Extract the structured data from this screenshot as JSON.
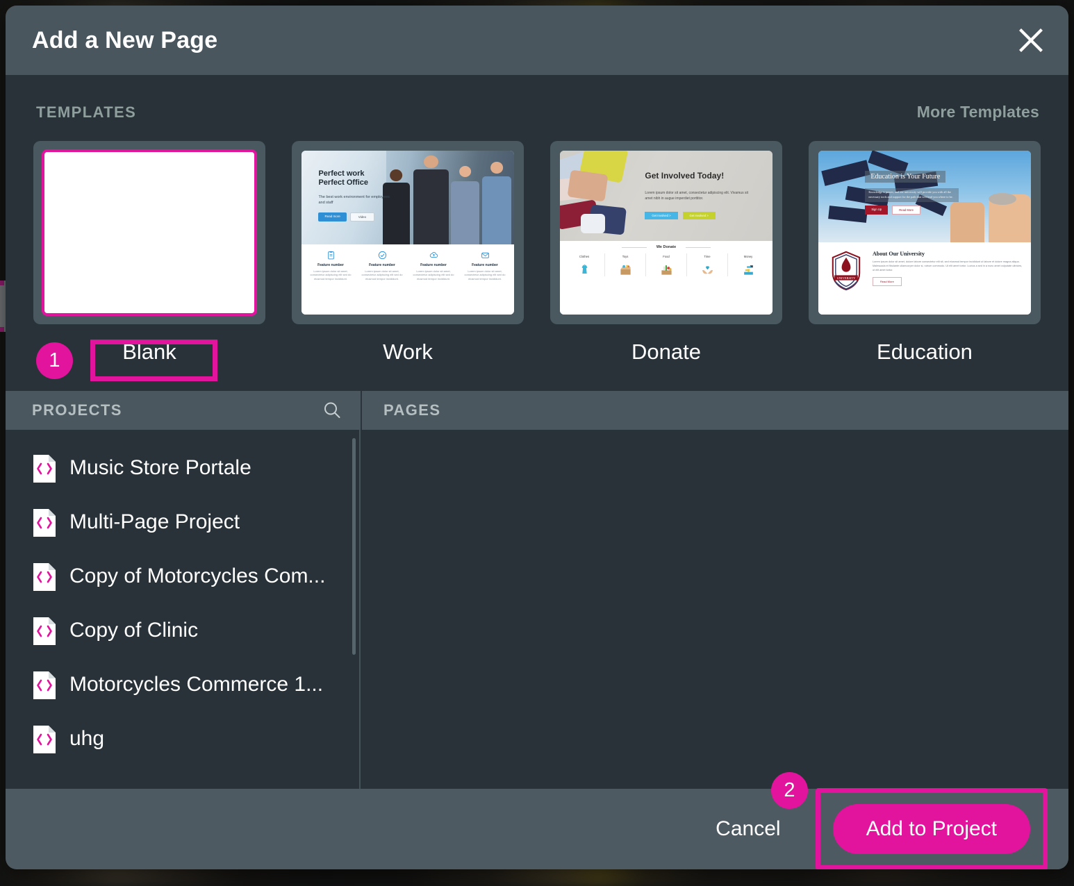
{
  "dialog": {
    "title": "Add a New Page",
    "close_icon": "close-icon"
  },
  "templates_section": {
    "label": "TEMPLATES",
    "more_link": "More Templates",
    "items": [
      {
        "label": "Blank",
        "selected": true
      },
      {
        "label": "Work",
        "selected": false
      },
      {
        "label": "Donate",
        "selected": false
      },
      {
        "label": "Education",
        "selected": false
      }
    ]
  },
  "template_previews": {
    "work": {
      "title_line1": "Perfect work",
      "title_line2": "Perfect Office",
      "subtitle": "The best work environment for employees and staff",
      "button_primary": "Read more",
      "button_secondary": "Video",
      "features": [
        {
          "title": "Feature number",
          "body": "Lorem ipsum dolor sit amet, consectetur adipiscing elit sed do eiusmod tempor incididunt."
        },
        {
          "title": "Feature number",
          "body": "Lorem ipsum dolor sit amet, consectetur adipiscing elit sed do eiusmod tempor incididunt."
        },
        {
          "title": "Feature number",
          "body": "Lorem ipsum dolor sit amet, consectetur adipiscing elit sed do eiusmod tempor incididunt."
        },
        {
          "title": "Feature number",
          "body": "Lorem ipsum dolor sit amet, consectetur adipiscing elit sed do eiusmod tempor incididunt."
        }
      ]
    },
    "donate": {
      "title": "Get Involved Today!",
      "subtitle": "Lorem ipsum dolor sit amet, consectetur adipiscing elit. Vivamus sit amet nibh in augue imperdiet porttitor.",
      "button_primary": "Get Involved >",
      "button_secondary": "Get Involved >",
      "section_title": "We Donate",
      "items": [
        {
          "label": "Clothes"
        },
        {
          "label": "Toys"
        },
        {
          "label": "Food"
        },
        {
          "label": "Time"
        },
        {
          "label": "Money"
        }
      ]
    },
    "education": {
      "title": "Education is Your Future",
      "subtitle": "Knowledge is power, and our university will provide you with all the necessary tools and support for the path that will lead you where to be.",
      "button_primary": "Sign Up",
      "button_secondary": "Read More",
      "about_title": "About Our University",
      "about_body": "Lorem ipsum dolor sit amet, dolore labore consectetur elit sit, sed eiusmod tempor incididunt ut labore et dolore magna aliqua. Malesuada et fibulante ullamcorper dolor si, rutrum commodo. Ut elit amet tortor. Luctus a sed in a nunc amet vulputate ultricies, ut elit amet tortor.",
      "about_button": "Read More",
      "crest_label": "UNIVERSITY"
    }
  },
  "projects_panel": {
    "label": "PROJECTS",
    "search_icon": "search-icon",
    "items": [
      {
        "name": "Music Store Portale"
      },
      {
        "name": "Multi-Page Project"
      },
      {
        "name": "Copy of Motorcycles Com..."
      },
      {
        "name": "Copy of Clinic"
      },
      {
        "name": "Motorcycles Commerce 1..."
      },
      {
        "name": "uhg"
      }
    ]
  },
  "pages_panel": {
    "label": "PAGES",
    "items": []
  },
  "footer": {
    "cancel_label": "Cancel",
    "add_label": "Add to Project"
  },
  "annotations": {
    "step1": "1",
    "step2": "2"
  },
  "colors": {
    "accent": "#e2139c",
    "dialog_body": "#283238",
    "dialog_header": "#4a565e",
    "dialog_footer": "#4e5a62",
    "muted_text": "#8f9f9d"
  }
}
